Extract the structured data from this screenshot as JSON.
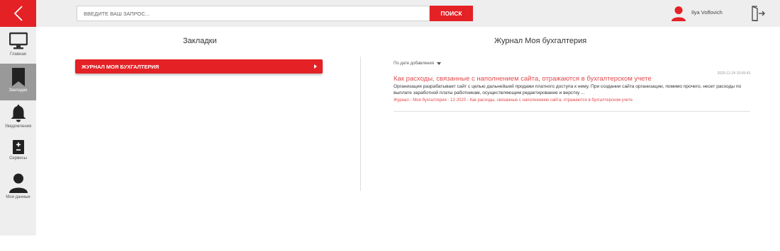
{
  "header": {
    "search_placeholder": "ВВЕДИТЕ ВАШ ЗАПРОС...",
    "search_button": "ПОИСК",
    "user_name": "Ilya Volfovich"
  },
  "sidebar": {
    "items": [
      {
        "label": "Главная",
        "icon": "monitor-icon"
      },
      {
        "label": "Закладки",
        "icon": "bookmark-icon",
        "active": true
      },
      {
        "label": "Уведомления",
        "icon": "bell-icon"
      },
      {
        "label": "Сервисы",
        "icon": "calculator-icon"
      },
      {
        "label": "Мои данные",
        "icon": "user-icon"
      }
    ]
  },
  "bookmarks": {
    "title": "Закладки",
    "items": [
      {
        "label": "ЖУРНАЛ МОЯ БУХГАЛТЕРИЯ"
      }
    ]
  },
  "journal": {
    "title": "Журнал Моя бухгалтерия",
    "sort_label": "По дате добавления",
    "articles": [
      {
        "date": "2020-12-24 10:09:43",
        "title": "Как расходы, связанные с наполнением сайта, отражаются в бухгалтерском учете",
        "text": "Организация разрабатывает сайт с целью дальнейшей продажи платного доступа к нему. При создании сайта организации, помимо прочего, несет расходы по выплате заработной платы работникам, осуществляющим редактирование и верстку ...",
        "breadcrumb": "Журнал - Моя бухгалтерия - 12-2020 - Как расходы, связанные с наполнением сайта, отражаются в бухгалтерском учете"
      }
    ]
  },
  "colors": {
    "accent": "#e42125",
    "link": "#e04b4e",
    "sidebar_bg": "#eeeeee",
    "sidebar_active": "#999999"
  }
}
